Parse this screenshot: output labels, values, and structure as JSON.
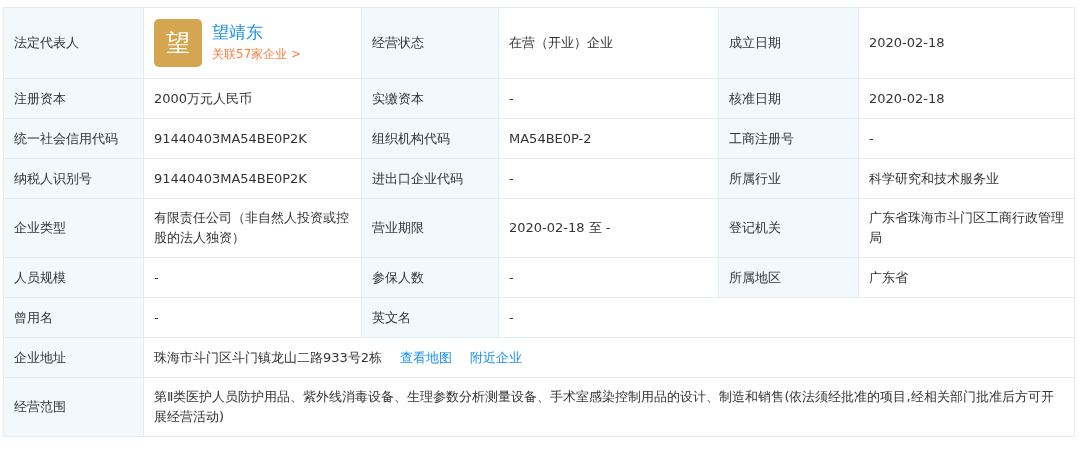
{
  "rows": [
    {
      "cells": [
        {
          "kind": "label",
          "text": "法定代表人"
        },
        {
          "kind": "person",
          "avatar": "望",
          "name": "望靖东",
          "related": "关联57家企业 >"
        },
        {
          "kind": "label",
          "text": "经营状态"
        },
        {
          "kind": "value",
          "text": "在营（开业）企业"
        },
        {
          "kind": "label",
          "text": "成立日期"
        },
        {
          "kind": "value",
          "text": "2020-02-18"
        }
      ]
    },
    {
      "cells": [
        {
          "kind": "label",
          "text": "注册资本"
        },
        {
          "kind": "value",
          "text": "2000万元人民币"
        },
        {
          "kind": "label",
          "text": "实缴资本"
        },
        {
          "kind": "value",
          "text": "-"
        },
        {
          "kind": "label",
          "text": "核准日期"
        },
        {
          "kind": "value",
          "text": "2020-02-18"
        }
      ]
    },
    {
      "cells": [
        {
          "kind": "label",
          "text": "统一社会信用代码"
        },
        {
          "kind": "value",
          "text": "91440403MA54BE0P2K"
        },
        {
          "kind": "label",
          "text": "组织机构代码"
        },
        {
          "kind": "value",
          "text": "MA54BE0P-2"
        },
        {
          "kind": "label",
          "text": "工商注册号"
        },
        {
          "kind": "value",
          "text": "-"
        }
      ]
    },
    {
      "cells": [
        {
          "kind": "label",
          "text": "纳税人识别号"
        },
        {
          "kind": "value",
          "text": "91440403MA54BE0P2K"
        },
        {
          "kind": "label",
          "text": "进出口企业代码"
        },
        {
          "kind": "value",
          "text": "-"
        },
        {
          "kind": "label",
          "text": "所属行业"
        },
        {
          "kind": "value",
          "text": "科学研究和技术服务业"
        }
      ]
    },
    {
      "cells": [
        {
          "kind": "label",
          "text": "企业类型"
        },
        {
          "kind": "value",
          "text": "有限责任公司（非自然人投资或控股的法人独资）"
        },
        {
          "kind": "label",
          "text": "营业期限"
        },
        {
          "kind": "value",
          "text": "2020-02-18 至 -"
        },
        {
          "kind": "label",
          "text": "登记机关"
        },
        {
          "kind": "value",
          "text": "广东省珠海市斗门区工商行政管理局"
        }
      ]
    },
    {
      "cells": [
        {
          "kind": "label",
          "text": "人员规模"
        },
        {
          "kind": "value",
          "text": "-"
        },
        {
          "kind": "label",
          "text": "参保人数"
        },
        {
          "kind": "value",
          "text": "-"
        },
        {
          "kind": "label",
          "text": "所属地区"
        },
        {
          "kind": "value",
          "text": "广东省"
        }
      ]
    },
    {
      "cells": [
        {
          "kind": "label",
          "text": "曾用名"
        },
        {
          "kind": "value",
          "text": "-"
        },
        {
          "kind": "label",
          "text": "英文名"
        },
        {
          "kind": "value",
          "text": "-"
        }
      ]
    },
    {
      "cells": [
        {
          "kind": "label",
          "text": "企业地址"
        },
        {
          "kind": "address",
          "text": "珠海市斗门区斗门镇龙山二路933号2栋",
          "links": [
            "查看地图",
            "附近企业"
          ]
        }
      ]
    },
    {
      "cells": [
        {
          "kind": "label",
          "text": "经营范围"
        },
        {
          "kind": "value",
          "text": "第Ⅱ类医护人员防护用品、紫外线消毒设备、生理参数分析测量设备、手术室感染控制用品的设计、制造和销售(依法须经批准的项目,经相关部门批准后方可开展经营活动)"
        }
      ]
    }
  ]
}
